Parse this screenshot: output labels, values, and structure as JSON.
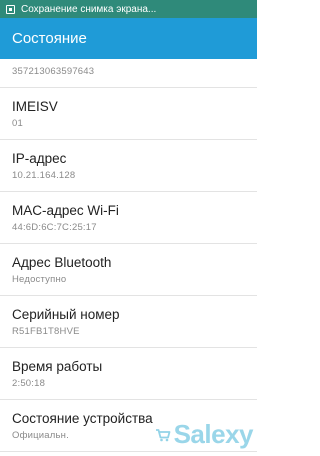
{
  "status_bar": {
    "notification_icon": "screenshot-icon",
    "text": "Сохранение снимка экрана..."
  },
  "action_bar": {
    "title": "Состояние"
  },
  "list": {
    "partial_value": "357213063597643",
    "items": [
      {
        "title": "IMEISV",
        "value": "01"
      },
      {
        "title": "IP-адрес",
        "value": "10.21.164.128"
      },
      {
        "title": "MAC-адрес Wi-Fi",
        "value": "44:6D:6C:7C:25:17"
      },
      {
        "title": "Адрес Bluetooth",
        "value": "Недоступно"
      },
      {
        "title": "Серийный номер",
        "value": "R51FB1T8HVE"
      },
      {
        "title": "Время работы",
        "value": "2:50:18"
      },
      {
        "title": "Состояние устройства",
        "value": "Официальн."
      }
    ]
  },
  "watermark": {
    "text": "Salexy",
    "icon": "cart-icon",
    "color": "#78c8e1"
  },
  "colors": {
    "status_bar": "#2f8a7a",
    "action_bar": "#1f9bd7",
    "divider": "#e3e3e3",
    "title_text": "#222222",
    "value_text": "#8a8a8a"
  }
}
